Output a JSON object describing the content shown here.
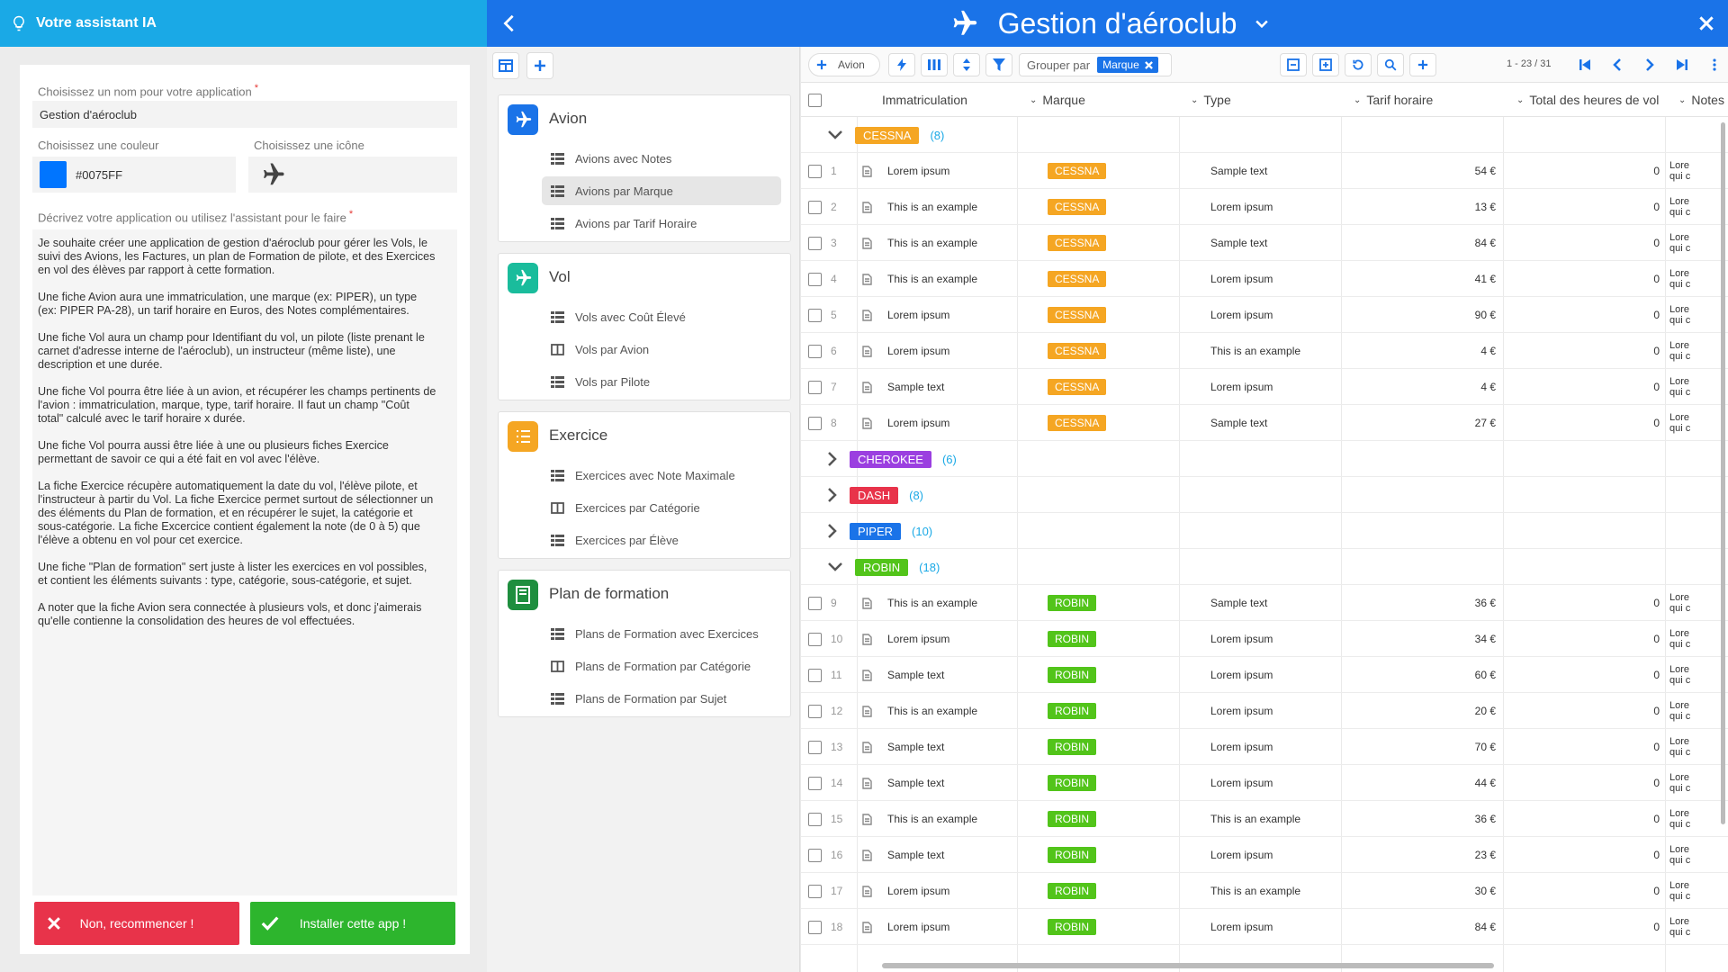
{
  "assistant": {
    "title": "Votre assistant IA",
    "name_label": "Choisissez un nom pour votre application",
    "name_value": "Gestion d'aéroclub",
    "color_label": "Choisissez une couleur",
    "color_value": "#0075FF",
    "icon_label": "Choisissez une icône",
    "desc_label": "Décrivez votre application ou utilisez l'assistant pour le faire",
    "desc_paragraphs": [
      "Je souhaite créer une application de gestion d'aéroclub pour gérer les Vols, le\nsuivi des Avions, les Factures, un plan de Formation de pilote, et des Exercices\nen vol des élèves par rapport à cette formation.",
      "Une fiche Avion aura une immatriculation, une marque (ex: PIPER), un type\n(ex: PIPER PA-28), un tarif horaire en Euros, des Notes complémentaires.",
      "Une fiche Vol aura un champ pour Identifiant du vol, un pilote (liste prenant le\ncarnet d'adresse interne de l'aéroclub), un instructeur (même liste), une\ndescription et une durée.",
      "Une fiche Vol pourra être liée à un avion, et récupérer les champs pertinents de\nl'avion : immatriculation, marque, type, tarif horaire. Il faut un champ \"Coût\ntotal\" calculé avec le tarif horaire x durée.",
      "Une fiche Vol pourra aussi être liée à une ou plusieurs fiches Exercice\npermettant de savoir ce qui a été fait en vol avec l'élève.",
      "La fiche Exercice récupère automatiquement la date du vol, l'élève pilote, et\nl'instructeur à partir du Vol. La fiche Exercice permet surtout de sélectionner un\ndes éléments du Plan de formation, et en récupérer le sujet, la catégorie et\nsous-catégorie. La fiche Excercice contient également la note (de 0 à 5) que\nl'élève a obtenu en vol pour cet exercice.",
      "Une fiche \"Plan de formation\" sert juste à lister les exercices en vol possibles,\net contient les éléments suivants : type, catégorie, sous-catégorie, et sujet.",
      "A noter que la fiche Avion sera connectée à plusieurs vols, et donc j'aimerais\nqu'elle contienne la consolidation des heures de vol effectuées."
    ],
    "btn_restart": "Non, recommencer !",
    "btn_install": "Installer cette app !"
  },
  "app": {
    "title": "Gestion d'aéroclub"
  },
  "groups": [
    {
      "title": "Avion",
      "color": "#1a73e8",
      "icon": "plane-icon",
      "items": [
        "Avions avec Notes",
        "Avions par Marque",
        "Avions par Tarif Horaire"
      ]
    },
    {
      "title": "Vol",
      "color": "#1abc9c",
      "icon": "plane-icon",
      "items": [
        "Vols avec Coût Élevé",
        "Vols par Avion",
        "Vols par Pilote"
      ]
    },
    {
      "title": "Exercice",
      "color": "#f5a623",
      "icon": "list-icon",
      "items": [
        "Exercices avec Note Maximale",
        "Exercices par Catégorie",
        "Exercices par Élève"
      ]
    },
    {
      "title": "Plan de formation",
      "color": "#1e8e3e",
      "icon": "book-icon",
      "items": [
        "Plans de Formation avec Exercices",
        "Plans de Formation par Catégorie",
        "Plans de Formation par Sujet"
      ]
    }
  ],
  "toolbar": {
    "add_label": "Avion",
    "group_by_label": "Grouper par",
    "group_by_value": "Marque",
    "pager": "1 - 23 / 31"
  },
  "columns": [
    "Immatriculation",
    "Marque",
    "Type",
    "Tarif horaire",
    "Total des heures de vol",
    "Notes"
  ],
  "cessna": {
    "label": "CESSNA",
    "count": "(8)",
    "color": "#f5a623"
  },
  "collapsed": [
    {
      "label": "CHEROKEE",
      "count": "(6)",
      "color": "#9b3fe0"
    },
    {
      "label": "DASH",
      "count": "(8)",
      "color": "#e8334a"
    },
    {
      "label": "PIPER",
      "count": "(10)",
      "color": "#1a73e8"
    }
  ],
  "robin": {
    "label": "ROBIN",
    "count": "(18)",
    "color": "#52c41a"
  },
  "cessna_rows": [
    {
      "n": "1",
      "imm": "Lorem ipsum",
      "brand": "CESSNA",
      "type": "Sample text",
      "rate": "54 €",
      "hours": "0",
      "notes": "Lore\nqui c"
    },
    {
      "n": "2",
      "imm": "This is an example",
      "brand": "CESSNA",
      "type": "Lorem ipsum",
      "rate": "13 €",
      "hours": "0",
      "notes": "Lore\nqui c"
    },
    {
      "n": "3",
      "imm": "This is an example",
      "brand": "CESSNA",
      "type": "Sample text",
      "rate": "84 €",
      "hours": "0",
      "notes": "Lore\nqui c"
    },
    {
      "n": "4",
      "imm": "This is an example",
      "brand": "CESSNA",
      "type": "Lorem ipsum",
      "rate": "41 €",
      "hours": "0",
      "notes": "Lore\nqui c"
    },
    {
      "n": "5",
      "imm": "Lorem ipsum",
      "brand": "CESSNA",
      "type": "Lorem ipsum",
      "rate": "90 €",
      "hours": "0",
      "notes": "Lore\nqui c"
    },
    {
      "n": "6",
      "imm": "Lorem ipsum",
      "brand": "CESSNA",
      "type": "This is an example",
      "rate": "4 €",
      "hours": "0",
      "notes": "Lore\nqui c"
    },
    {
      "n": "7",
      "imm": "Sample text",
      "brand": "CESSNA",
      "type": "Lorem ipsum",
      "rate": "4 €",
      "hours": "0",
      "notes": "Lore\nqui c"
    },
    {
      "n": "8",
      "imm": "Lorem ipsum",
      "brand": "CESSNA",
      "type": "Sample text",
      "rate": "27 €",
      "hours": "0",
      "notes": "Lore\nqui c"
    }
  ],
  "robin_rows": [
    {
      "n": "9",
      "imm": "This is an example",
      "brand": "ROBIN",
      "type": "Sample text",
      "rate": "36 €",
      "hours": "0",
      "notes": "Lore\nqui c"
    },
    {
      "n": "10",
      "imm": "Lorem ipsum",
      "brand": "ROBIN",
      "type": "Lorem ipsum",
      "rate": "34 €",
      "hours": "0",
      "notes": "Lore\nqui c"
    },
    {
      "n": "11",
      "imm": "Sample text",
      "brand": "ROBIN",
      "type": "Lorem ipsum",
      "rate": "60 €",
      "hours": "0",
      "notes": "Lore\nqui c"
    },
    {
      "n": "12",
      "imm": "This is an example",
      "brand": "ROBIN",
      "type": "Lorem ipsum",
      "rate": "20 €",
      "hours": "0",
      "notes": "Lore\nqui c"
    },
    {
      "n": "13",
      "imm": "Sample text",
      "brand": "ROBIN",
      "type": "Lorem ipsum",
      "rate": "70 €",
      "hours": "0",
      "notes": "Lore\nqui c"
    },
    {
      "n": "14",
      "imm": "Sample text",
      "brand": "ROBIN",
      "type": "Lorem ipsum",
      "rate": "44 €",
      "hours": "0",
      "notes": "Lore\nqui c"
    },
    {
      "n": "15",
      "imm": "This is an example",
      "brand": "ROBIN",
      "type": "This is an example",
      "rate": "36 €",
      "hours": "0",
      "notes": "Lore\nqui c"
    },
    {
      "n": "16",
      "imm": "Sample text",
      "brand": "ROBIN",
      "type": "Lorem ipsum",
      "rate": "23 €",
      "hours": "0",
      "notes": "Lore\nqui c"
    },
    {
      "n": "17",
      "imm": "Lorem ipsum",
      "brand": "ROBIN",
      "type": "This is an example",
      "rate": "30 €",
      "hours": "0",
      "notes": "Lore\nqui c"
    },
    {
      "n": "18",
      "imm": "Lorem ipsum",
      "brand": "ROBIN",
      "type": "Lorem ipsum",
      "rate": "84 €",
      "hours": "0",
      "notes": "Lore\nqui c"
    }
  ]
}
